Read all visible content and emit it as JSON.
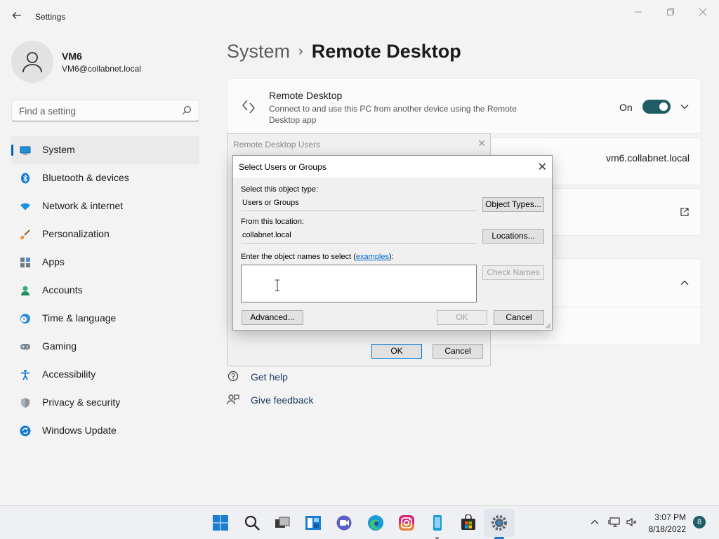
{
  "window": {
    "app_title": "Settings",
    "back_icon": "arrow-left-icon",
    "controls": [
      "minimize-icon",
      "restore-icon",
      "close-icon"
    ]
  },
  "profile": {
    "name": "VM6",
    "email": "VM6@collabnet.local"
  },
  "search": {
    "placeholder": "Find a setting"
  },
  "sidebar": {
    "items": [
      {
        "label": "System",
        "icon": "monitor-icon",
        "active": true
      },
      {
        "label": "Bluetooth & devices",
        "icon": "bluetooth-icon"
      },
      {
        "label": "Network & internet",
        "icon": "wifi-icon"
      },
      {
        "label": "Personalization",
        "icon": "brush-icon"
      },
      {
        "label": "Apps",
        "icon": "apps-icon"
      },
      {
        "label": "Accounts",
        "icon": "person-icon"
      },
      {
        "label": "Time & language",
        "icon": "clock-globe-icon"
      },
      {
        "label": "Gaming",
        "icon": "gamepad-icon"
      },
      {
        "label": "Accessibility",
        "icon": "accessibility-icon"
      },
      {
        "label": "Privacy & security",
        "icon": "shield-icon"
      },
      {
        "label": "Windows Update",
        "icon": "sync-icon"
      }
    ]
  },
  "main": {
    "breadcrumb_parent": "System",
    "breadcrumb_current": "Remote Desktop",
    "remote_desktop": {
      "title": "Remote Desktop",
      "description": "Connect to and use this PC from another device using the Remote Desktop app",
      "state": "On",
      "enabled": true
    },
    "pc_name": "vm6.collabnet.local",
    "help": {
      "get_help": "Get help",
      "give_feedback": "Give feedback"
    }
  },
  "dialog_back": {
    "title": "Remote Desktop Users",
    "ok": "OK",
    "cancel": "Cancel"
  },
  "dialog": {
    "title": "Select Users or Groups",
    "object_type_label": "Select this object type:",
    "object_type_value": "Users or Groups",
    "object_types_button": "Object Types...",
    "location_label": "From this location:",
    "location_value": "collabnet.local",
    "locations_button": "Locations...",
    "names_label_prefix": "Enter the object names to select (",
    "names_label_link": "examples",
    "names_label_suffix": "):",
    "names_value": "",
    "check_names_button": "Check Names",
    "advanced_button": "Advanced...",
    "ok_button": "OK",
    "cancel_button": "Cancel"
  },
  "taskbar": {
    "apps": [
      "start-icon",
      "search-icon",
      "task-view-icon",
      "widgets-icon",
      "teams-chat-icon",
      "edge-icon",
      "instagram-icon",
      "phone-app-icon",
      "store-icon",
      "settings-icon"
    ],
    "time": "3:07 PM",
    "date": "8/18/2022",
    "notification_count": "8"
  }
}
